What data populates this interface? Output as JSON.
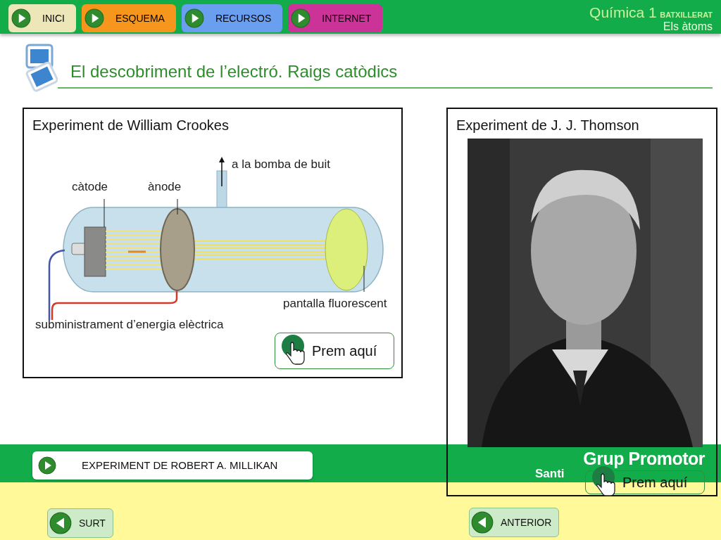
{
  "nav": [
    {
      "label": "INICI",
      "color": "#ede6b8"
    },
    {
      "label": "ESQUEMA",
      "color": "#f7961d"
    },
    {
      "label": "RECURSOS",
      "color": "#6a9ff0"
    },
    {
      "label": "INTERNET",
      "color": "#cc3399"
    }
  ],
  "header": {
    "course": "Química 1",
    "level": "BATXILLERAT",
    "unit": "Els àtoms"
  },
  "title": "El descobriment de l’electró. Raigs catòdics",
  "crookes": {
    "title": "Experiment de William Crookes",
    "labels": {
      "pump": "a la bomba de buit",
      "cathode": "càtode",
      "anode": "ànode",
      "screen": "pantalla fluorescent",
      "supply": "subministrament d’energia elèctrica"
    },
    "button": "Prem aquí"
  },
  "thomson": {
    "title": "Experiment de J. J. Thomson",
    "logo": [
      "Grup Promotor",
      "Santi"
    ],
    "button": "Prem aquí"
  },
  "link_button": "EXPERIMENT DE ROBERT A. MILLIKAN",
  "footer": [
    {
      "label": "SURT"
    },
    {
      "label": "ANTERIOR"
    }
  ]
}
